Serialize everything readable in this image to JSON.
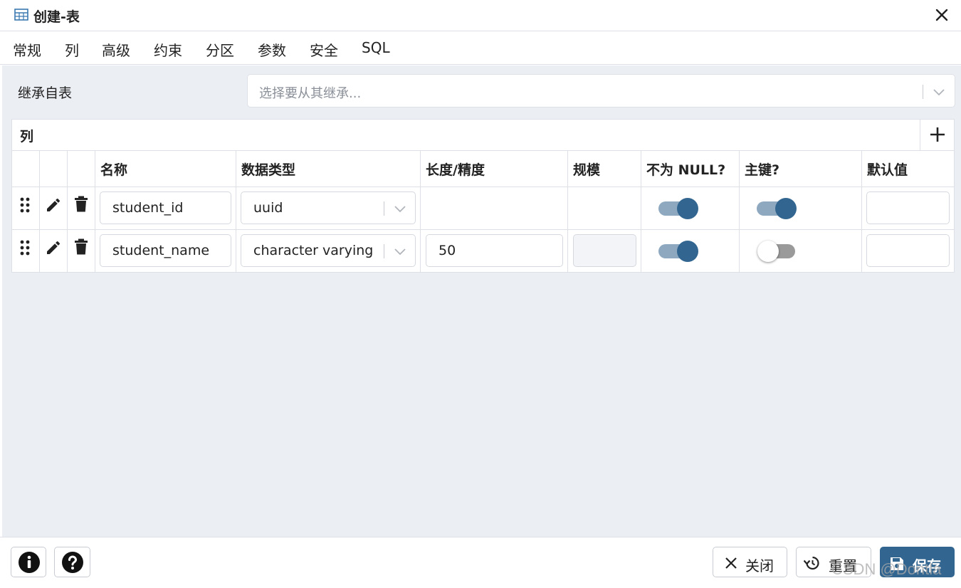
{
  "window": {
    "title": "创建-表",
    "icon": "table-icon"
  },
  "tabs": [
    {
      "label": "常规",
      "active": false
    },
    {
      "label": "列",
      "active": true
    },
    {
      "label": "高级",
      "active": false
    },
    {
      "label": "约束",
      "active": false
    },
    {
      "label": "分区",
      "active": false
    },
    {
      "label": "参数",
      "active": false
    },
    {
      "label": "安全",
      "active": false
    },
    {
      "label": "SQL",
      "active": false
    }
  ],
  "inherit": {
    "label": "继承自表",
    "placeholder": "选择要从其继承..."
  },
  "columns_panel": {
    "title": "列",
    "headers": [
      "名称",
      "数据类型",
      "长度/精度",
      "规模",
      "不为 NULL?",
      "主键?",
      "默认值"
    ],
    "rows": [
      {
        "name": "student_id",
        "data_type": "uuid",
        "length": "",
        "scale": "",
        "not_null": true,
        "primary_key": true,
        "default": ""
      },
      {
        "name": "student_name",
        "data_type": "character varying",
        "length": "50",
        "scale": "",
        "not_null": true,
        "primary_key": false,
        "default": ""
      }
    ]
  },
  "footer": {
    "close_label": "关闭",
    "reset_label": "重置",
    "save_label": "保存"
  },
  "watermark": "CSDN @Dontla",
  "colors": {
    "accent": "#326690",
    "toggle_track_on": "#8da8bf",
    "content_bg": "#ebeef3"
  }
}
